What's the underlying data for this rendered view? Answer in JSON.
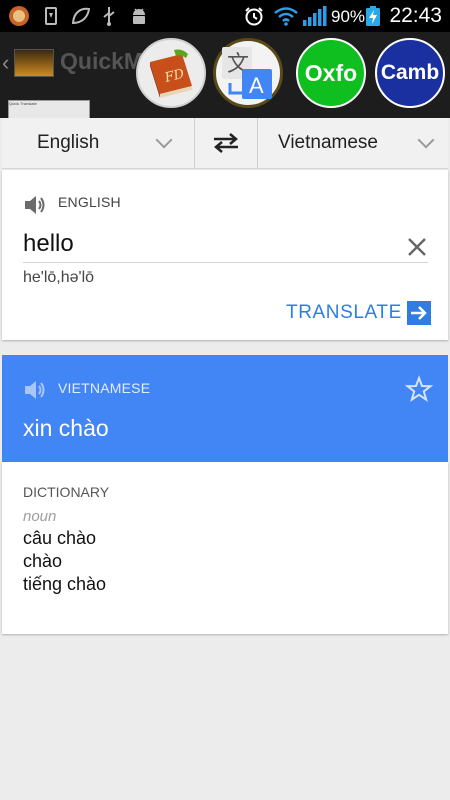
{
  "status_bar": {
    "battery_percent": "90%",
    "time": "22:43"
  },
  "app_behind": {
    "title": "QuickM",
    "mini_text": "Quick Translate"
  },
  "bubbles": {
    "fd_label": "FD",
    "google_translate_glyph": "文",
    "google_translate_letter": "A",
    "oxford_label": "Oxfo",
    "cambridge_label": "Camb"
  },
  "languages": {
    "source": "English",
    "target": "Vietnamese"
  },
  "source_card": {
    "label": "ENGLISH",
    "text": "hello",
    "phonetic": "he'lō,hə'lō",
    "translate_button": "TRANSLATE"
  },
  "result_card": {
    "label": "VIETNAMESE",
    "text": "xin chào"
  },
  "dictionary": {
    "label": "DICTIONARY",
    "part_of_speech": "noun",
    "entries": [
      "câu chào",
      "chào",
      "tiếng chào"
    ]
  },
  "colors": {
    "accent_blue": "#4285f4",
    "link_blue": "#2f7de1",
    "oxford_green": "#0fbf1f",
    "cambridge_navy": "#1a2fa0"
  }
}
